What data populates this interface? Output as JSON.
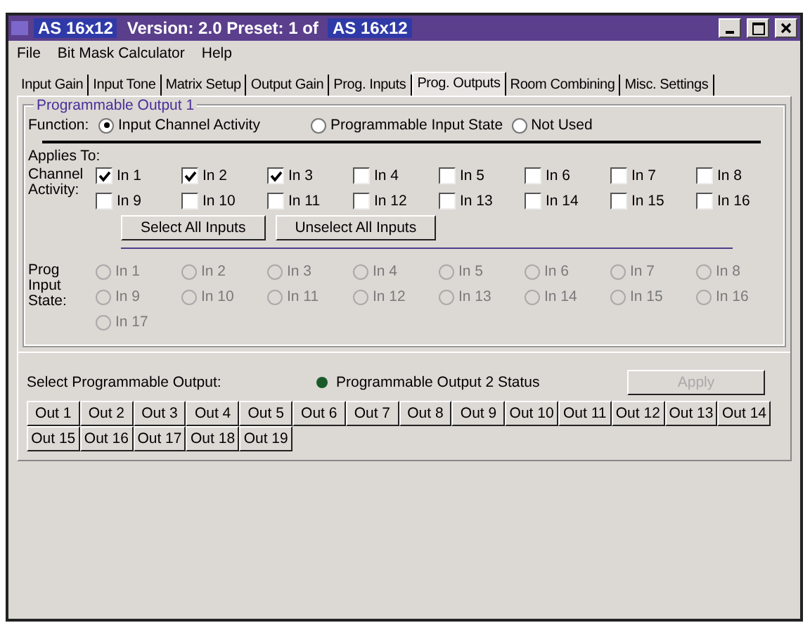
{
  "window": {
    "title_parts": [
      {
        "text": "AS 16x12",
        "highlighted": true
      },
      {
        "text": "Version: 2.0  Preset: 1 of",
        "highlighted": false
      },
      {
        "text": "AS 16x12",
        "highlighted": true
      }
    ]
  },
  "menu": [
    "File",
    "Bit Mask Calculator",
    "Help"
  ],
  "tabs": [
    {
      "label": "Input Gain",
      "selected": false
    },
    {
      "label": "Input Tone",
      "selected": false
    },
    {
      "label": "Matrix Setup",
      "selected": false
    },
    {
      "label": "Output Gain",
      "selected": false
    },
    {
      "label": "Prog. Inputs",
      "selected": false
    },
    {
      "label": "Prog. Outputs",
      "selected": true
    },
    {
      "label": "Room Combining",
      "selected": false
    },
    {
      "label": "Misc. Settings",
      "selected": false
    }
  ],
  "group": {
    "title": "Programmable Output 1",
    "function_label": "Function:",
    "function_options": [
      {
        "label": "Input Channel Activity",
        "selected": true
      },
      {
        "label": "Programmable Input State",
        "selected": false
      },
      {
        "label": "Not Used",
        "selected": false
      }
    ],
    "applies_to": "Applies To:",
    "channel_label": "Channel Activity:",
    "channels": [
      {
        "label": "In 1",
        "checked": true
      },
      {
        "label": "In 2",
        "checked": true
      },
      {
        "label": "In 3",
        "checked": true
      },
      {
        "label": "In 4",
        "checked": false
      },
      {
        "label": "In 5",
        "checked": false
      },
      {
        "label": "In 6",
        "checked": false
      },
      {
        "label": "In 7",
        "checked": false
      },
      {
        "label": "In 8",
        "checked": false
      },
      {
        "label": "In 9",
        "checked": false
      },
      {
        "label": "In 10",
        "checked": false
      },
      {
        "label": "In 11",
        "checked": false
      },
      {
        "label": "In 12",
        "checked": false
      },
      {
        "label": "In 13",
        "checked": false
      },
      {
        "label": "In 14",
        "checked": false
      },
      {
        "label": "In 15",
        "checked": false
      },
      {
        "label": "In 16",
        "checked": false
      }
    ],
    "buttons": [
      "Select All Inputs",
      "Unselect All Inputs"
    ],
    "state_label": "Prog Input State:",
    "states": [
      {
        "label": "In 1",
        "selected": false
      },
      {
        "label": "In 2",
        "selected": false
      },
      {
        "label": "In 3",
        "selected": false
      },
      {
        "label": "In 4",
        "selected": false
      },
      {
        "label": "In 5",
        "selected": false
      },
      {
        "label": "In 6",
        "selected": false
      },
      {
        "label": "In 7",
        "selected": false
      },
      {
        "label": "In 8",
        "selected": false
      },
      {
        "label": "In 9",
        "selected": false
      },
      {
        "label": "In 10",
        "selected": false
      },
      {
        "label": "In 11",
        "selected": false
      },
      {
        "label": "In 12",
        "selected": false
      },
      {
        "label": "In 13",
        "selected": false
      },
      {
        "label": "In 14",
        "selected": false
      },
      {
        "label": "In 15",
        "selected": false
      },
      {
        "label": "In 16",
        "selected": false
      },
      {
        "label": "In 17",
        "selected": false
      }
    ],
    "states_disabled": true
  },
  "select_label": "Select Programmable Output:",
  "status": {
    "label": "Programmable Output 2 Status",
    "on": true
  },
  "apply": {
    "label": "Apply",
    "disabled": true
  },
  "outputs": [
    "Out 1",
    "Out 2",
    "Out 3",
    "Out 4",
    "Out 5",
    "Out 6",
    "Out 7",
    "Out 8",
    "Out 9",
    "Out 10",
    "Out 11",
    "Out 12",
    "Out 13",
    "Out 14",
    "Out 15",
    "Out 16",
    "Out 17",
    "Out 18",
    "Out 19"
  ]
}
